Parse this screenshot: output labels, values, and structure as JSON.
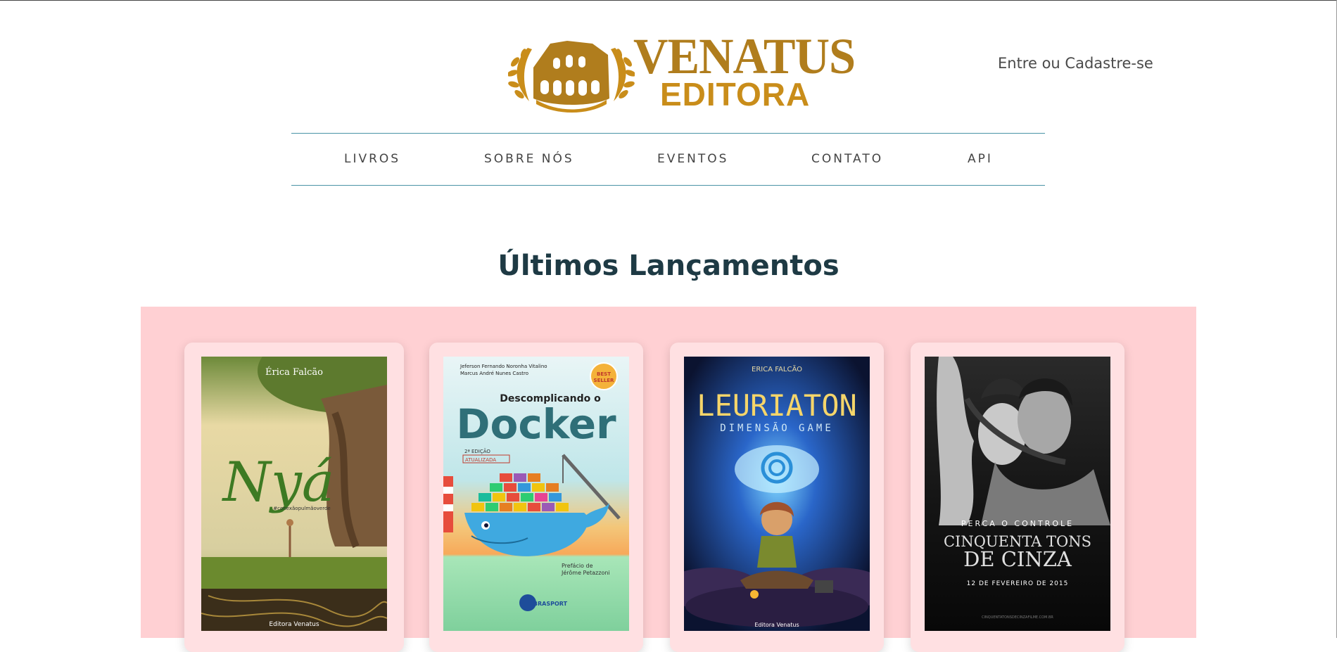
{
  "brand": {
    "name_line1": "VENATUS",
    "name_line2": "EDITORA",
    "gold": "#b07d1d"
  },
  "header": {
    "auth_link": "Entre ou Cadastre-se"
  },
  "nav": {
    "items": [
      {
        "label": "LIVROS"
      },
      {
        "label": "SOBRE NÓS"
      },
      {
        "label": "EVENTOS"
      },
      {
        "label": "CONTATO"
      },
      {
        "label": "API"
      }
    ],
    "rule_color": "#4a93a6"
  },
  "releases": {
    "title": "Últimos Lançamentos",
    "band_color": "#ffd0d3",
    "books": [
      {
        "cover_author": "Érica Falcão",
        "cover_title": "Nyá",
        "cover_tagline": "#conexãopulmãoverde",
        "cover_publisher": "Editora Venatus"
      },
      {
        "cover_author_1": "Jeferson Fernando Noronha Vitalino",
        "cover_author_2": "Marcus André Nunes Castro",
        "cover_badge_1": "BEST",
        "cover_badge_2": "SELLER",
        "cover_subtitle": "Descomplicando o",
        "cover_title": "Docker",
        "cover_edition_1": "2ª EDIÇÃO",
        "cover_edition_2": "ATUALIZADA",
        "cover_preface_1": "Prefácio de",
        "cover_preface_2": "Jérôme Petazzoni",
        "cover_publisher": "BRASPORT"
      },
      {
        "cover_author": "ERICA FALCÃO",
        "cover_title": "LEURIATON",
        "cover_subtitle": "DIMENSÃO GAME",
        "cover_publisher": "Editora Venatus"
      },
      {
        "cover_tagline": "PERCA O CONTROLE",
        "cover_title_1": "CINQUENTA TONS",
        "cover_title_2": "DE CINZA",
        "cover_date": "12 DE FEVEREIRO DE 2015",
        "cover_url": "CINQUENTATONSDECINZAFILME.COM.BR"
      }
    ]
  }
}
